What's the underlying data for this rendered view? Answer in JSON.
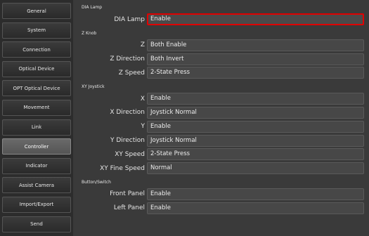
{
  "sidebar": {
    "items": [
      {
        "label": "General"
      },
      {
        "label": "System"
      },
      {
        "label": "Connection"
      },
      {
        "label": "Optical Device"
      },
      {
        "label": "OPT Optical Device"
      },
      {
        "label": "Movement"
      },
      {
        "label": "Link"
      },
      {
        "label": "Controller"
      },
      {
        "label": "Indicator"
      },
      {
        "label": "Assist Camera"
      },
      {
        "label": "Import/Export"
      },
      {
        "label": "Send"
      }
    ],
    "active_item": "Controller"
  },
  "sections": {
    "dia_lamp": {
      "title": "DIA Lamp",
      "rows": [
        {
          "label": "DIA Lamp",
          "value": "Enable"
        }
      ]
    },
    "z_knob": {
      "title": "Z Knob",
      "rows": [
        {
          "label": "Z",
          "value": "Both Enable"
        },
        {
          "label": "Z Direction",
          "value": "Both Invert"
        },
        {
          "label": "Z Speed",
          "value": "2-State Press"
        }
      ]
    },
    "xy_joystick": {
      "title": "XY Joystick",
      "rows": [
        {
          "label": "X",
          "value": "Enable"
        },
        {
          "label": "X Direction",
          "value": "Joystick Normal"
        },
        {
          "label": "Y",
          "value": "Enable"
        },
        {
          "label": "Y Direction",
          "value": "Joystick Normal"
        },
        {
          "label": "XY Speed",
          "value": "2-State Press"
        },
        {
          "label": "XY Fine Speed",
          "value": "Normal"
        }
      ]
    },
    "button_switch": {
      "title": "Button/Switch",
      "rows": [
        {
          "label": "Front Panel",
          "value": "Enable"
        },
        {
          "label": "Left Panel",
          "value": "Enable"
        }
      ]
    }
  },
  "colors": {
    "selection_border": "#e00000",
    "background": "#3a3a3a",
    "sidebar_background": "#2c2c2c"
  }
}
